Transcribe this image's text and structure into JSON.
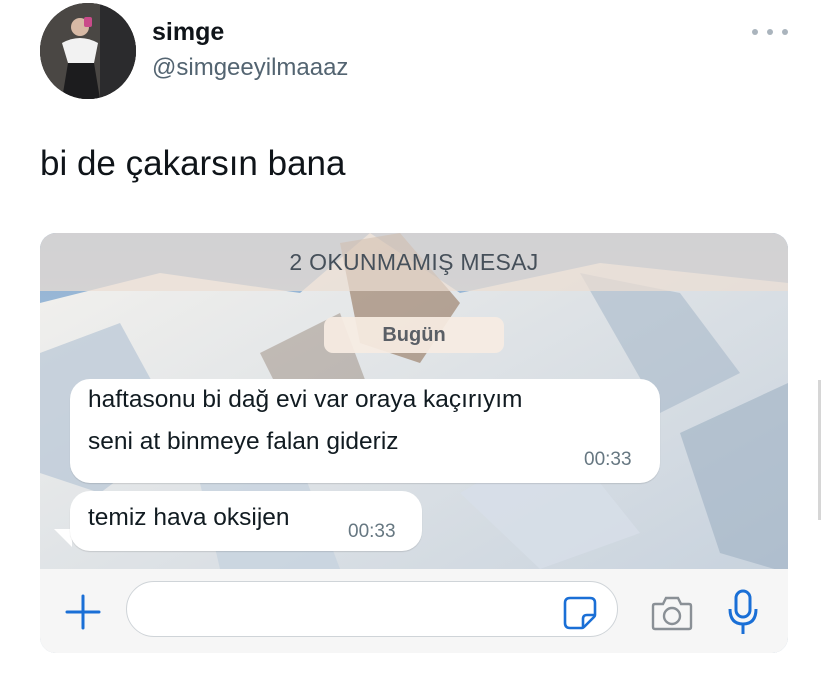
{
  "tweet": {
    "author_name": "simge",
    "author_handle": "@simgeeyilmaaaz",
    "text": "bi de çakarsın bana"
  },
  "chat": {
    "unread_banner": "2 OKUNMAMIŞ MESAJ",
    "date_label": "Bugün",
    "messages": [
      {
        "lines": [
          "haftasonu bi dağ evi var oraya kaçırıyım",
          "seni at binmeye falan gideriz"
        ],
        "time": "00:33"
      },
      {
        "lines": [
          "temiz hava oksijen"
        ],
        "time": "00:33"
      }
    ],
    "input_placeholder": "",
    "accent_color": "#1a6fd6",
    "icons": [
      "plus-icon",
      "sticker-icon",
      "camera-icon",
      "microphone-icon"
    ]
  }
}
